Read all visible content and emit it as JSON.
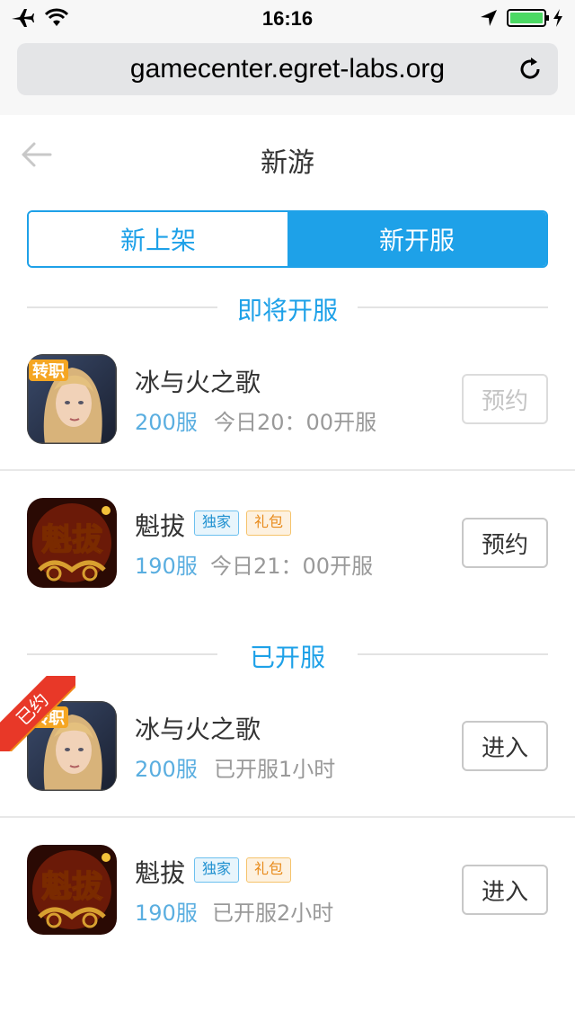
{
  "status_bar": {
    "time": "16:16"
  },
  "browser": {
    "url": "gamecenter.egret-labs.org"
  },
  "nav": {
    "title": "新游"
  },
  "tabs": [
    {
      "label": "新上架",
      "active": false
    },
    {
      "label": "新开服",
      "active": true
    }
  ],
  "sections": [
    {
      "title": "即将开服",
      "games": [
        {
          "name": "冰与火之歌",
          "server": "200服",
          "time": "今日20：00开服",
          "action": "预约",
          "action_state": "disabled",
          "icon": "ice-fire-game-icon",
          "icon_badge": "转职",
          "tags": []
        },
        {
          "name": "魁拔",
          "server": "190服",
          "time": "今日21：00开服",
          "action": "预约",
          "action_state": "enabled",
          "icon": "kuiba-game-icon",
          "icon_text": "魁拔",
          "tags": [
            "独家",
            "礼包"
          ]
        }
      ]
    },
    {
      "title": "已开服",
      "games": [
        {
          "name": "冰与火之歌",
          "server": "200服",
          "time": "已开服1小时",
          "action": "进入",
          "action_state": "enabled",
          "icon": "ice-fire-game-icon",
          "icon_badge": "转职",
          "ribbon": "已约",
          "tags": []
        },
        {
          "name": "魁拔",
          "server": "190服",
          "time": "已开服2小时",
          "action": "进入",
          "action_state": "enabled",
          "icon": "kuiba-game-icon",
          "icon_text": "魁拔",
          "tags": [
            "独家",
            "礼包"
          ]
        }
      ]
    }
  ],
  "colors": {
    "accent": "#1ea1e8",
    "server_blue": "#5aaee0",
    "muted": "#999999"
  }
}
